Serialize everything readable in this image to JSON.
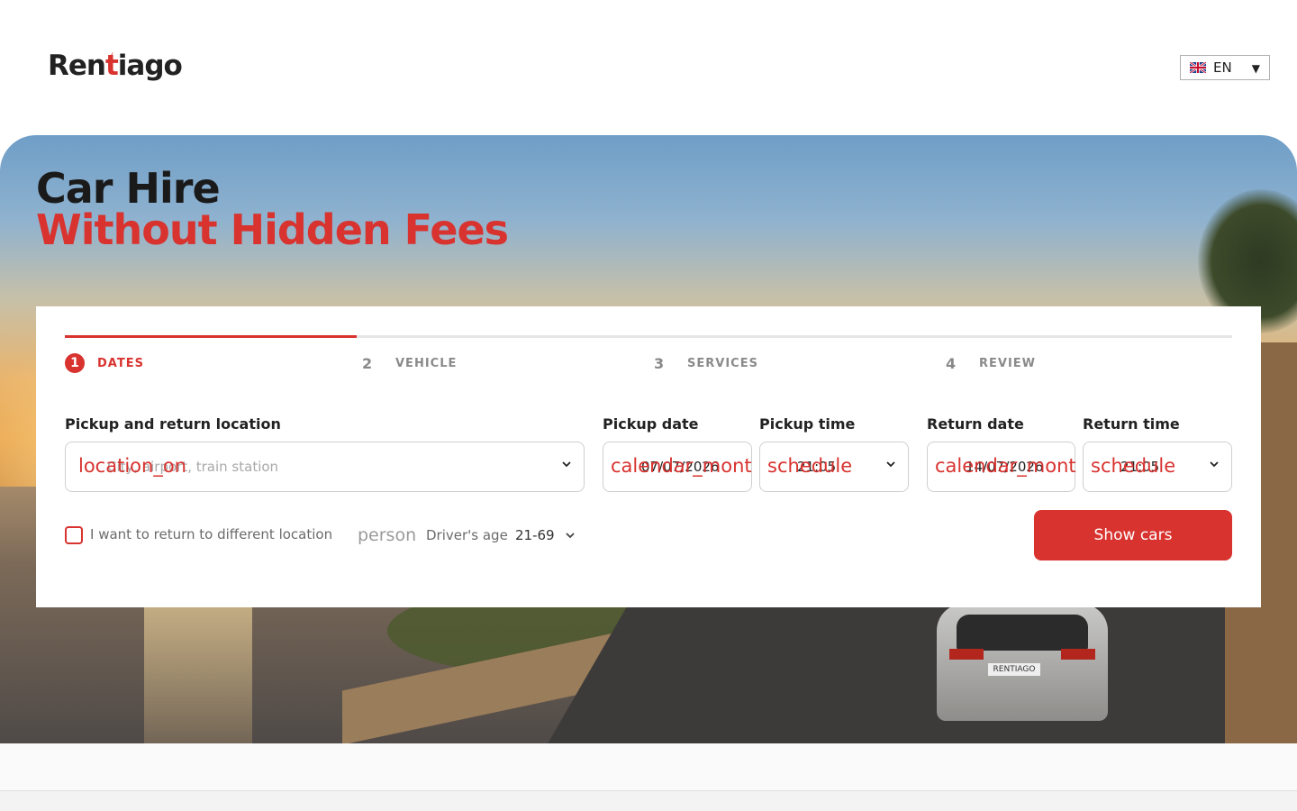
{
  "header": {
    "logo": {
      "text_part1": "Ren",
      "text_accent": "t",
      "text_part2": "iago"
    },
    "language": {
      "flag_icon": "uk-flag-icon",
      "label": "EN",
      "caret_icon": "caret-down-icon"
    }
  },
  "hero": {
    "title_line1": "Car Hire",
    "title_line2": "Without Hidden Fees",
    "plate_text": "RENTIAGO"
  },
  "booking": {
    "steps": [
      {
        "number": "1",
        "label": "DATES",
        "active": true
      },
      {
        "number": "2",
        "label": "VEHICLE",
        "active": false
      },
      {
        "number": "3",
        "label": "SERVICES",
        "active": false
      },
      {
        "number": "4",
        "label": "REVIEW",
        "active": false
      }
    ],
    "progress_fraction": 0.25,
    "location": {
      "label": "Pickup and return location",
      "icon_text": "location_on",
      "placeholder": "City, airport, train station"
    },
    "pickup_date": {
      "label": "Pickup date",
      "icon_text": "calendar_mont",
      "value": "07/07/2026"
    },
    "pickup_time": {
      "label": "Pickup time",
      "icon_text": "schedule",
      "value": "21:05"
    },
    "return_date": {
      "label": "Return date",
      "icon_text": "calendar_mont",
      "value": "14/07/2026"
    },
    "return_time": {
      "label": "Return time",
      "icon_text": "schedule",
      "value": "21:05"
    },
    "different_location": {
      "label": "I want to return to different location",
      "checked": false
    },
    "driver_age": {
      "icon_text": "person",
      "label": "Driver's age",
      "value": "21-69"
    },
    "submit_label": "Show cars"
  },
  "colors": {
    "accent": "#d8332f",
    "text": "#222222",
    "muted": "#6b6b6b"
  }
}
